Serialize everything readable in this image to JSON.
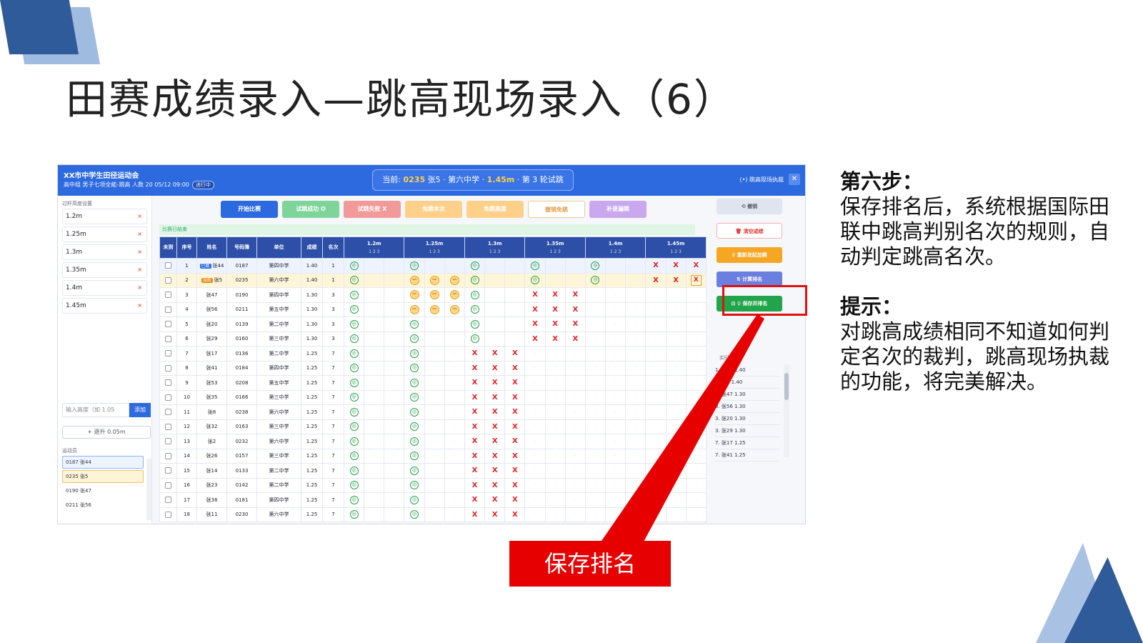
{
  "slide": {
    "title": "田赛成绩录入—跳高现场录入（6）",
    "step_heading": "第六步：",
    "step_text": "保存排名后，系统根据国际田联中跳高判别名次的规则，自动判定跳高名次。",
    "tip_heading": "提示：",
    "tip_text": "对跳高成绩相同不知道如何判定名次的裁判，跳高现场执裁的功能，将完美解决。",
    "callout_label": "保存排名"
  },
  "app": {
    "org": "XX市中学生田径运动会",
    "subtitle": "高中组 男子七项全能-跳高  人数 20  05/12 09:00",
    "state_badge": "进行中",
    "current_prefix": "当前:",
    "current_bib": "0235",
    "current_name": "张5 · 第六中学 ·",
    "current_height": "1.45m",
    "current_round": "· 第 3 轮试跳",
    "mode_label": "(•) 跳高现场执裁",
    "close_label": "✕"
  },
  "left": {
    "heights_title": "过杆高度设置",
    "heights": [
      "1.2m",
      "1.25m",
      "1.3m",
      "1.35m",
      "1.4m",
      "1.45m"
    ],
    "remove_label": "×",
    "height_input_placeholder": "输入高度（如 1.05",
    "add_label": "添加",
    "step_label": "+ 逐升 0.05m",
    "athletes_title": "运动员",
    "athletes": [
      "0187 张44",
      "0235 张5",
      "0190 张47",
      "0211 张56"
    ]
  },
  "toolbar": {
    "start": "开始比赛",
    "success": "试跳成功 O",
    "fail": "试跳失败 X",
    "skip_once": "免跳本次",
    "skip_height": "免跳高度",
    "cancel_skip": "撤销免跳",
    "backfill": "补录漏跳"
  },
  "colors": {
    "start": "#2d6ae0",
    "success": "#7fd49a",
    "fail": "#f29a9a",
    "skip_once": "#ffd08a",
    "skip_height": "#ffd08a",
    "cancel_skip": "#ffffff",
    "backfill": "#c9a8f0",
    "undo": "#dfe4ee",
    "clear": "#ffffff",
    "restart": "#f5a623",
    "calc": "#6b7fe0",
    "save": "#22a44a"
  },
  "status_text": "比赛已结束",
  "table": {
    "headers": [
      "未到",
      "序号",
      "姓名",
      "号码簿",
      "单位",
      "成绩",
      "名次"
    ],
    "heights": [
      "1.2m",
      "1.25m",
      "1.3m",
      "1.35m",
      "1.4m",
      "1.45m"
    ],
    "attempt_label": "1 2 3",
    "tag_done": "已跳",
    "tag_current": "当前",
    "rows": [
      {
        "no": "1",
        "name": "张44",
        "bib": "0187",
        "unit": "第四中学",
        "result": "1.40",
        "rank": "1",
        "tag": "done",
        "attempts": [
          "O--",
          "O--",
          "O--",
          "O--",
          "O--",
          "XXX"
        ]
      },
      {
        "no": "2",
        "name": "张5",
        "bib": "0235",
        "unit": "第六中学",
        "result": "1.40",
        "rank": "1",
        "tag": "current",
        "attempts": [
          "O--",
          "SSS",
          "O--",
          "O--",
          "O--",
          "XXX"
        ]
      },
      {
        "no": "3",
        "name": "张47",
        "bib": "0190",
        "unit": "第四中学",
        "result": "1.30",
        "rank": "3",
        "attempts": [
          "O--",
          "SSS",
          "O--",
          "XXX",
          "---",
          "---"
        ]
      },
      {
        "no": "4",
        "name": "张56",
        "bib": "0211",
        "unit": "第五中学",
        "result": "1.30",
        "rank": "3",
        "attempts": [
          "O--",
          "SSS",
          "O--",
          "XXX",
          "---",
          "---"
        ]
      },
      {
        "no": "5",
        "name": "张20",
        "bib": "0139",
        "unit": "第二中学",
        "result": "1.30",
        "rank": "3",
        "attempts": [
          "O--",
          "O--",
          "O--",
          "XXX",
          "---",
          "---"
        ]
      },
      {
        "no": "6",
        "name": "张29",
        "bib": "0160",
        "unit": "第三中学",
        "result": "1.30",
        "rank": "3",
        "attempts": [
          "O--",
          "O--",
          "O--",
          "XXX",
          "---",
          "---"
        ]
      },
      {
        "no": "7",
        "name": "张17",
        "bib": "0136",
        "unit": "第二中学",
        "result": "1.25",
        "rank": "7",
        "attempts": [
          "O--",
          "O--",
          "XXX",
          "---",
          "---",
          "---"
        ]
      },
      {
        "no": "8",
        "name": "张41",
        "bib": "0184",
        "unit": "第四中学",
        "result": "1.25",
        "rank": "7",
        "attempts": [
          "O--",
          "O--",
          "XXX",
          "---",
          "---",
          "---"
        ]
      },
      {
        "no": "9",
        "name": "张53",
        "bib": "0208",
        "unit": "第五中学",
        "result": "1.25",
        "rank": "7",
        "attempts": [
          "O--",
          "O--",
          "XXX",
          "---",
          "---",
          "---"
        ]
      },
      {
        "no": "10",
        "name": "张35",
        "bib": "0166",
        "unit": "第三中学",
        "result": "1.25",
        "rank": "7",
        "attempts": [
          "O--",
          "O--",
          "XXX",
          "---",
          "---",
          "---"
        ]
      },
      {
        "no": "11",
        "name": "张8",
        "bib": "0238",
        "unit": "第六中学",
        "result": "1.25",
        "rank": "7",
        "attempts": [
          "O--",
          "O--",
          "XXX",
          "---",
          "---",
          "---"
        ]
      },
      {
        "no": "12",
        "name": "张32",
        "bib": "0163",
        "unit": "第三中学",
        "result": "1.25",
        "rank": "7",
        "attempts": [
          "O--",
          "O--",
          "XXX",
          "---",
          "---",
          "---"
        ]
      },
      {
        "no": "13",
        "name": "张2",
        "bib": "0232",
        "unit": "第六中学",
        "result": "1.25",
        "rank": "7",
        "attempts": [
          "O--",
          "O--",
          "XXX",
          "---",
          "---",
          "---"
        ]
      },
      {
        "no": "14",
        "name": "张26",
        "bib": "0157",
        "unit": "第三中学",
        "result": "1.25",
        "rank": "7",
        "attempts": [
          "O--",
          "O--",
          "XXX",
          "---",
          "---",
          "---"
        ]
      },
      {
        "no": "15",
        "name": "张14",
        "bib": "0133",
        "unit": "第二中学",
        "result": "1.25",
        "rank": "7",
        "attempts": [
          "O--",
          "O--",
          "XXX",
          "---",
          "---",
          "---"
        ]
      },
      {
        "no": "16",
        "name": "张23",
        "bib": "0142",
        "unit": "第二中学",
        "result": "1.25",
        "rank": "7",
        "attempts": [
          "O--",
          "O--",
          "XXX",
          "---",
          "---",
          "---"
        ]
      },
      {
        "no": "17",
        "name": "张38",
        "bib": "0181",
        "unit": "第四中学",
        "result": "1.25",
        "rank": "7",
        "attempts": [
          "O--",
          "O--",
          "XXX",
          "---",
          "---",
          "---"
        ]
      },
      {
        "no": "18",
        "name": "张11",
        "bib": "0230",
        "unit": "第六中学",
        "result": "1.25",
        "rank": "7",
        "attempts": [
          "O--",
          "O--",
          "XXX",
          "---",
          "---",
          "---"
        ]
      }
    ]
  },
  "right": {
    "undo": "⟲ 撤销",
    "clear": "🗑 清空成绩",
    "restart": "♀ 重新发起加赛",
    "calc": "⇅ 计算排名",
    "save": "⊡ ♀ 保存并排名",
    "rank_title": "实时排名",
    "ranks": [
      "1. 张44 1.40",
      "1. 张5 1.40",
      "3. 张47 1.30",
      "3. 张56 1.30",
      "3. 张20 1.30",
      "3. 张29 1.30",
      "7. 张17 1.25",
      "7. 张41 1.25"
    ]
  }
}
